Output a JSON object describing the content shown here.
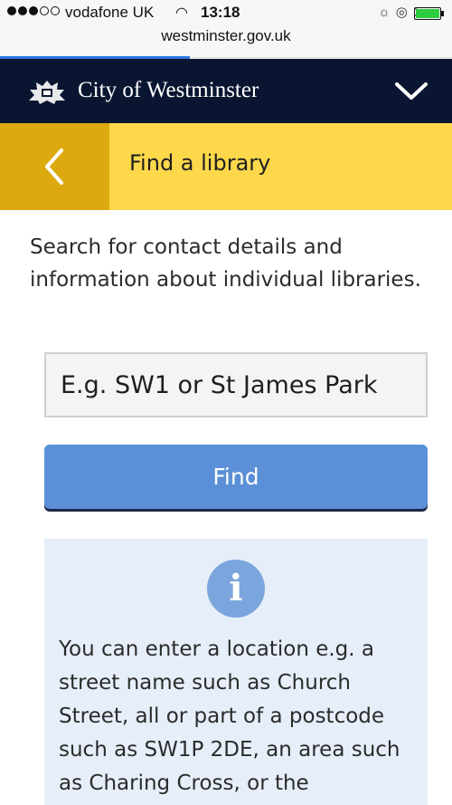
{
  "status_bar": {
    "carrier": "vodafone UK",
    "time": "13:18",
    "url": "westminster.gov.uk",
    "signal_bars_filled": 3,
    "signal_bars_total": 5,
    "icons": [
      "wifi-icon",
      "brightness-icon",
      "alarm-icon",
      "location-icon",
      "battery-icon"
    ]
  },
  "header": {
    "brand": "City of Westminster",
    "icons": [
      "crest-icon",
      "chevron-down-icon"
    ]
  },
  "breadcrumb": {
    "title": "Find a library",
    "icons": [
      "chevron-left-icon"
    ]
  },
  "main": {
    "intro": "Search for contact details and information about individual libraries.",
    "search_placeholder": "E.g. SW1 or St James Park",
    "find_label": "Find"
  },
  "info": {
    "icon_glyph": "i",
    "text": "You can enter a location e.g. a street name such as Church Street, all or part of a postcode such as SW1P 2DE, an area such as Charing Cross, or the"
  },
  "colors": {
    "header_bg": "#0a1631",
    "crumb_bg": "#fdd84b",
    "back_bg": "#dcaa0f",
    "button_bg": "#5b8fd7",
    "info_bg": "#e6eef9",
    "info_icon": "#7aa5dd"
  }
}
